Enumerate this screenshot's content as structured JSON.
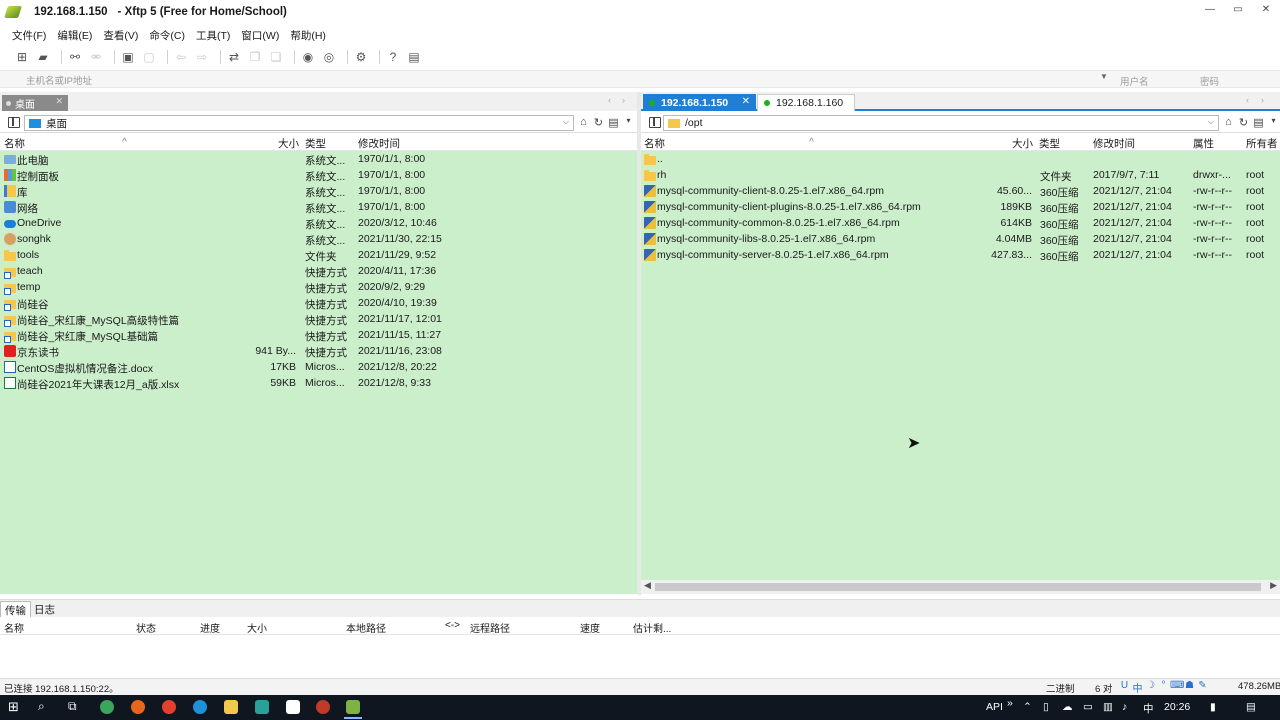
{
  "window": {
    "host": "192.168.1.150",
    "title": "- Xftp 5 (Free for Home/School)",
    "controls": [
      "—",
      "▭",
      "✕"
    ]
  },
  "menu": [
    "文件(F)",
    "编辑(E)",
    "查看(V)",
    "命令(C)",
    "工具(T)",
    "窗口(W)",
    "帮助(H)"
  ],
  "address": {
    "placeholder": "主机名或IP地址",
    "user_placeholder": "用户名",
    "pass_placeholder": "密码"
  },
  "left": {
    "tab": "桌面",
    "path": "桌面",
    "columns": [
      "名称",
      "大小",
      "类型",
      "修改时间"
    ],
    "files": [
      {
        "name": "此电脑",
        "size": "",
        "type": "系统文...",
        "modified": "1970/1/1, 8:00",
        "icon": "pc"
      },
      {
        "name": "控制面板",
        "size": "",
        "type": "系统文...",
        "modified": "1970/1/1, 8:00",
        "icon": "cp"
      },
      {
        "name": "库",
        "size": "",
        "type": "系统文...",
        "modified": "1970/1/1, 8:00",
        "icon": "lib"
      },
      {
        "name": "网络",
        "size": "",
        "type": "系统文...",
        "modified": "1970/1/1, 8:00",
        "icon": "net"
      },
      {
        "name": "OneDrive",
        "size": "",
        "type": "系统文...",
        "modified": "2020/3/12, 10:46",
        "icon": "cloud"
      },
      {
        "name": "songhk",
        "size": "",
        "type": "系统文...",
        "modified": "2021/11/30, 22:15",
        "icon": "user"
      },
      {
        "name": "tools",
        "size": "",
        "type": "文件夹",
        "modified": "2021/11/29, 9:52",
        "icon": "folder"
      },
      {
        "name": "teach",
        "size": "",
        "type": "快捷方式",
        "modified": "2020/4/11, 17:36",
        "icon": "lnk"
      },
      {
        "name": "temp",
        "size": "",
        "type": "快捷方式",
        "modified": "2020/9/2, 9:29",
        "icon": "lnk"
      },
      {
        "name": "尚硅谷",
        "size": "",
        "type": "快捷方式",
        "modified": "2020/4/10, 19:39",
        "icon": "lnk"
      },
      {
        "name": "尚硅谷_宋红康_MySQL高级特性篇",
        "size": "",
        "type": "快捷方式",
        "modified": "2021/11/17, 12:01",
        "icon": "lnk"
      },
      {
        "name": "尚硅谷_宋红康_MySQL基础篇",
        "size": "",
        "type": "快捷方式",
        "modified": "2021/11/15, 11:27",
        "icon": "lnk"
      },
      {
        "name": "京东读书",
        "size": "941 By...",
        "type": "快捷方式",
        "modified": "2021/11/16, 23:08",
        "icon": "jd"
      },
      {
        "name": "CentOS虚拟机情况备注.docx",
        "size": "17KB",
        "type": "Micros...",
        "modified": "2021/12/8, 20:22",
        "icon": "doc"
      },
      {
        "name": "尚硅谷2021年大课表12月_a版.xlsx",
        "size": "59KB",
        "type": "Micros...",
        "modified": "2021/12/8, 9:33",
        "icon": "xls"
      }
    ]
  },
  "right": {
    "tabs": [
      "192.168.1.150",
      "192.168.1.160"
    ],
    "path": "/opt",
    "columns": [
      "名称",
      "大小",
      "类型",
      "修改时间",
      "属性",
      "所有者"
    ],
    "files": [
      {
        "name": "..",
        "size": "",
        "type": "",
        "modified": "",
        "attr": "",
        "owner": "",
        "icon": "folder"
      },
      {
        "name": "rh",
        "size": "",
        "type": "文件夹",
        "modified": "2017/9/7, 7:11",
        "attr": "drwxr-...",
        "owner": "root",
        "icon": "folder"
      },
      {
        "name": "mysql-community-client-8.0.25-1.el7.x86_64.rpm",
        "size": "45.60...",
        "type": "360压缩",
        "modified": "2021/12/7, 21:04",
        "attr": "-rw-r--r--",
        "owner": "root",
        "icon": "rpm"
      },
      {
        "name": "mysql-community-client-plugins-8.0.25-1.el7.x86_64.rpm",
        "size": "189KB",
        "type": "360压缩",
        "modified": "2021/12/7, 21:04",
        "attr": "-rw-r--r--",
        "owner": "root",
        "icon": "rpm"
      },
      {
        "name": "mysql-community-common-8.0.25-1.el7.x86_64.rpm",
        "size": "614KB",
        "type": "360压缩",
        "modified": "2021/12/7, 21:04",
        "attr": "-rw-r--r--",
        "owner": "root",
        "icon": "rpm"
      },
      {
        "name": "mysql-community-libs-8.0.25-1.el7.x86_64.rpm",
        "size": "4.04MB",
        "type": "360压缩",
        "modified": "2021/12/7, 21:04",
        "attr": "-rw-r--r--",
        "owner": "root",
        "icon": "rpm"
      },
      {
        "name": "mysql-community-server-8.0.25-1.el7.x86_64.rpm",
        "size": "427.83...",
        "type": "360压缩",
        "modified": "2021/12/7, 21:04",
        "attr": "-rw-r--r--",
        "owner": "root",
        "icon": "rpm"
      }
    ]
  },
  "bottom": {
    "tabs": [
      "传输",
      "日志"
    ],
    "columns": [
      "名称",
      "状态",
      "进度",
      "大小",
      "本地路径",
      "<->",
      "远程路径",
      "速度",
      "估计剩..."
    ]
  },
  "status": {
    "left": "已连接 192.168.1.150:22。",
    "mode": "二进制",
    "count": "6 对",
    "size": "478.26MB",
    "ime": [
      "U",
      "中",
      "☽",
      "°",
      "⌨",
      "☗",
      "✎"
    ]
  },
  "taskbar": {
    "api": "API",
    "ime_cn": "中",
    "time": "20:26",
    "tray_chevrons": "»"
  }
}
